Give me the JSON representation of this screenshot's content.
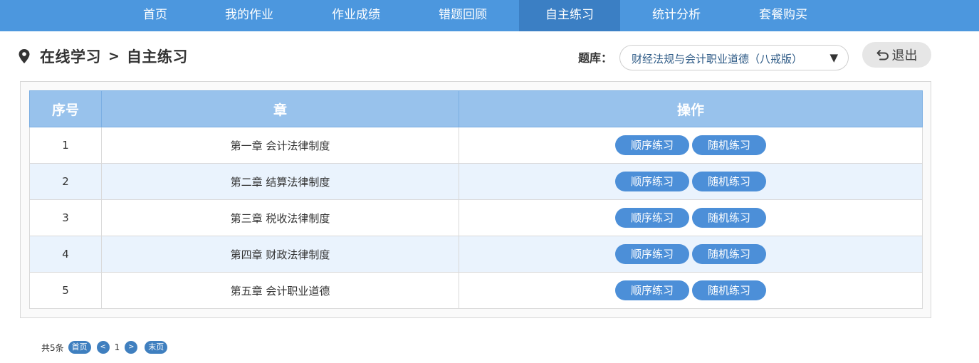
{
  "nav": {
    "items": [
      {
        "label": "首页",
        "active": false
      },
      {
        "label": "我的作业",
        "active": false
      },
      {
        "label": "作业成绩",
        "active": false
      },
      {
        "label": "错题回顾",
        "active": false
      },
      {
        "label": "自主练习",
        "active": true
      },
      {
        "label": "统计分析",
        "active": false
      },
      {
        "label": "套餐购买",
        "active": false
      }
    ]
  },
  "breadcrumb": {
    "icon": "location-pin-icon",
    "parent": "在线学习",
    "separator": ">",
    "current": "自主练习"
  },
  "question_bank": {
    "label": "题库：",
    "selected": "财经法规与会计职业道德（八戒版）",
    "arrow": "▼"
  },
  "exit_button": {
    "icon": "undo-arrow-icon",
    "label": "退出"
  },
  "table": {
    "headers": [
      "序号",
      "章",
      "操作"
    ],
    "rows": [
      {
        "no": "1",
        "chapter": "第一章 会计法律制度",
        "seq_btn": "顺序练习",
        "rand_btn": "随机练习"
      },
      {
        "no": "2",
        "chapter": "第二章 结算法律制度",
        "seq_btn": "顺序练习",
        "rand_btn": "随机练习"
      },
      {
        "no": "3",
        "chapter": "第三章 税收法律制度",
        "seq_btn": "顺序练习",
        "rand_btn": "随机练习"
      },
      {
        "no": "4",
        "chapter": "第四章 财政法律制度",
        "seq_btn": "顺序练习",
        "rand_btn": "随机练习"
      },
      {
        "no": "5",
        "chapter": "第五章 会计职业道德",
        "seq_btn": "顺序练习",
        "rand_btn": "随机练习"
      }
    ]
  },
  "pagination": {
    "total": "共5条",
    "first": "首页",
    "prev": "<",
    "page": "1",
    "next": ">",
    "last": "末页"
  },
  "colors": {
    "nav_bg": "#4c97de",
    "nav_active_bg": "#3b7fc4",
    "header_bg": "#98c2ec",
    "alt_row_bg": "#eaf3fd",
    "button_bg": "#4c8fd8"
  }
}
